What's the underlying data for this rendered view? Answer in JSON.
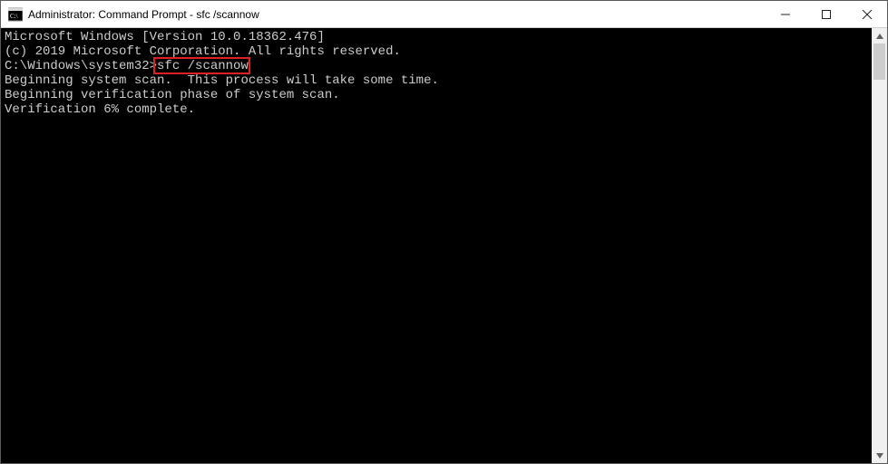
{
  "window": {
    "title": "Administrator: Command Prompt - sfc  /scannow"
  },
  "terminal": {
    "line1": "Microsoft Windows [Version 10.0.18362.476]",
    "line2": "(c) 2019 Microsoft Corporation. All rights reserved.",
    "blank1": "",
    "prompt": "C:\\Windows\\system32>",
    "command": "sfc /scannow",
    "blank2": "",
    "line3": "Beginning system scan.  This process will take some time.",
    "blank3": "",
    "line4": "Beginning verification phase of system scan.",
    "line5": "Verification 6% complete."
  },
  "colors": {
    "highlight": "#e02020"
  }
}
